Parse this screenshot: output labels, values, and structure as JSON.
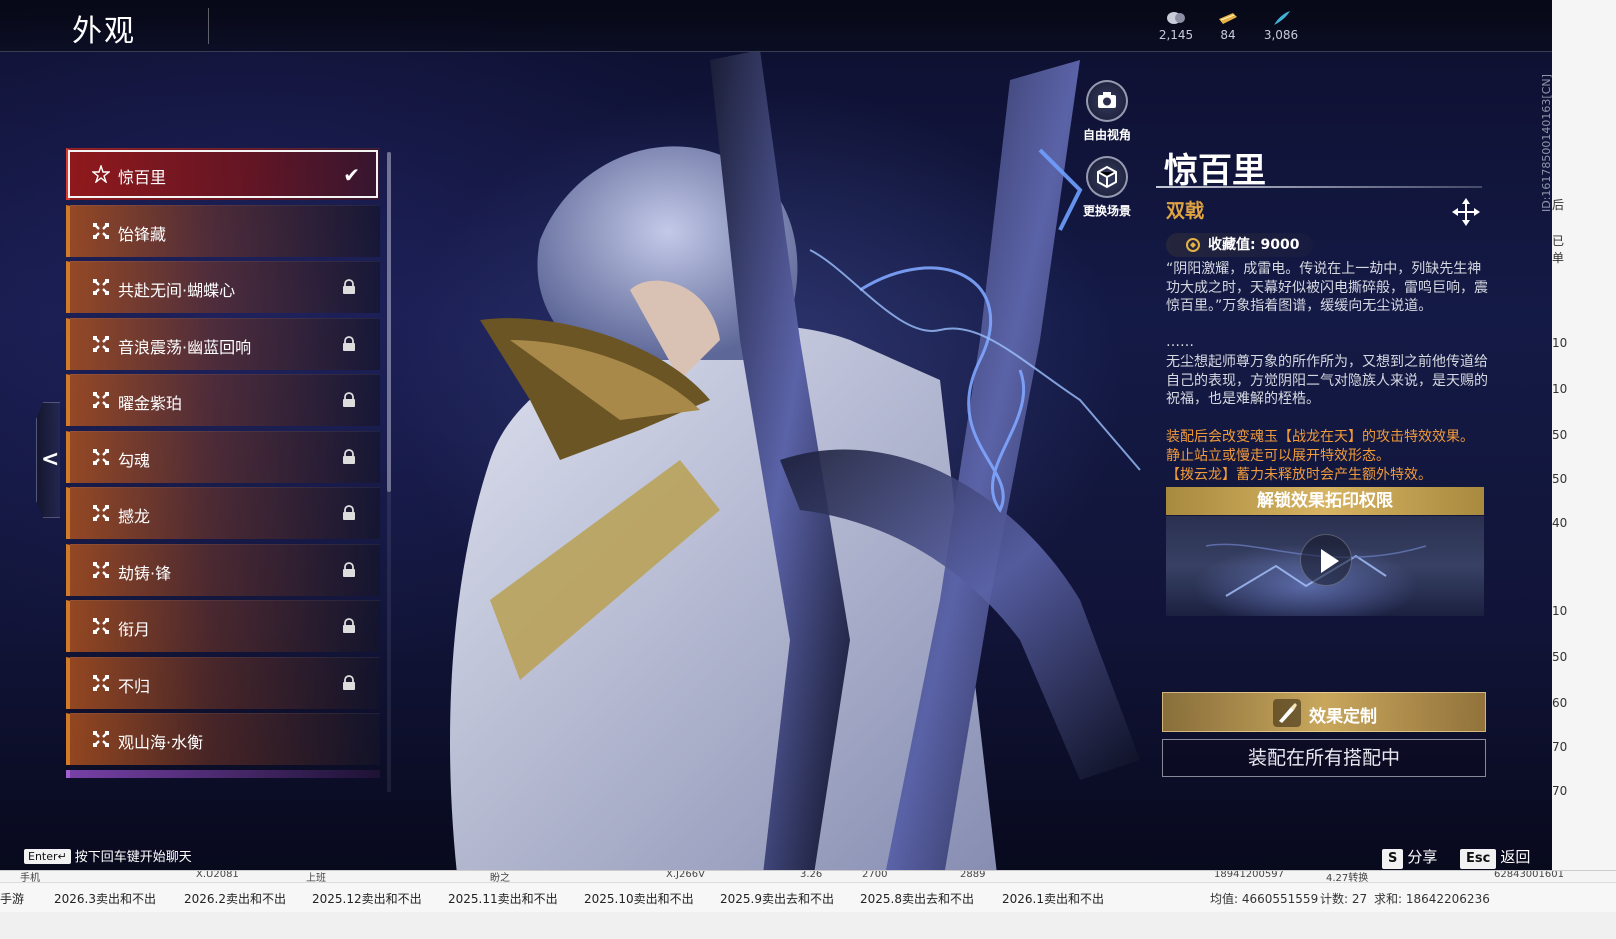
{
  "header": {
    "title": "外观"
  },
  "currencies": [
    {
      "icon": "crystal-ball-icon",
      "value": "2,145"
    },
    {
      "icon": "gold-ticket-icon",
      "value": "84"
    },
    {
      "icon": "feather-icon",
      "value": "3,086"
    }
  ],
  "view_buttons": {
    "free_view": "自由视角",
    "change_scene": "更换场景"
  },
  "skin_list": [
    {
      "label": "惊百里",
      "selected": true,
      "locked": false
    },
    {
      "label": "饴锋藏",
      "selected": false,
      "locked": false
    },
    {
      "label": "共赴无间·蝴蝶心",
      "selected": false,
      "locked": true
    },
    {
      "label": "音浪震荡·幽蓝回响",
      "selected": false,
      "locked": true
    },
    {
      "label": "曜金紫珀",
      "selected": false,
      "locked": true
    },
    {
      "label": "勾魂",
      "selected": false,
      "locked": true
    },
    {
      "label": "撼龙",
      "selected": false,
      "locked": true
    },
    {
      "label": "劫铸·锋",
      "selected": false,
      "locked": true
    },
    {
      "label": "衔月",
      "selected": false,
      "locked": true
    },
    {
      "label": "不归",
      "selected": false,
      "locked": true
    },
    {
      "label": "观山海·水衡",
      "selected": false,
      "locked": false
    }
  ],
  "detail": {
    "name": "惊百里",
    "weapon_type": "双戟",
    "collection_label": "收藏值: 9000",
    "quote": "“阴阳激耀，成雷电。传说在上一劫中，列缺先生神功大成之时，天幕好似被闪电撕碎般，雷鸣巨响，震惊百里。”万象指着图谱，缓缓向无尘说道。",
    "ellipsis": "……",
    "story": "无尘想起师尊万象的所作所为，又想到之前他传道给自己的表现，方觉阴阳二气对隐族人来说，是天赐的祝福，也是难解的桎梏。",
    "effect_lines": [
      "装配后会改变魂玉【战龙在天】的攻击特效效果。",
      "静止站立或慢走可以展开特效形态。",
      "【拨云龙】蓄力未释放时会产生额外特效。"
    ],
    "unlock_label": "解锁效果拓印权限",
    "customize_label": "效果定制",
    "equip_label": "装配在所有搭配中"
  },
  "footer": {
    "chat_key": "Enter↵",
    "chat_hint": "按下回车键开始聊天",
    "share_key": "S",
    "share_label": "分享",
    "back_key": "Esc",
    "back_label": "返回"
  },
  "player_id": "ID:1617850014016​3[CN]",
  "background_app": {
    "sheet_cells": [
      "手机",
      "X.U2081",
      "上班",
      "盼之",
      "X.J266V",
      "3.26",
      "2700",
      "2889",
      "18941200597",
      "4.27转换",
      "62843001601"
    ],
    "tabs": [
      "手游",
      "2026.3卖出和不出",
      "2026.2卖出和不出",
      "2025.12卖出和不出",
      "2025.11卖出和不出",
      "2025.10卖出和不出",
      "2025.9卖出去和不出",
      "2025.8卖出去和不出",
      "2026.1卖出和不出"
    ],
    "stats": {
      "avg": "均值: 4660551559",
      "count": "计数: 27",
      "sum": "求和: 18642206236"
    },
    "right_edge_values": [
      "后",
      "已单",
      "10",
      "10",
      "50",
      "50",
      "40",
      "10",
      "50",
      "60",
      "70",
      "70"
    ]
  },
  "colors": {
    "accent_orange": "#d07a2a",
    "selected_red": "#e03a30",
    "effect_text": "#f09a3a",
    "weapon_type": "#e0a341",
    "gold_button": "#d7b463"
  }
}
